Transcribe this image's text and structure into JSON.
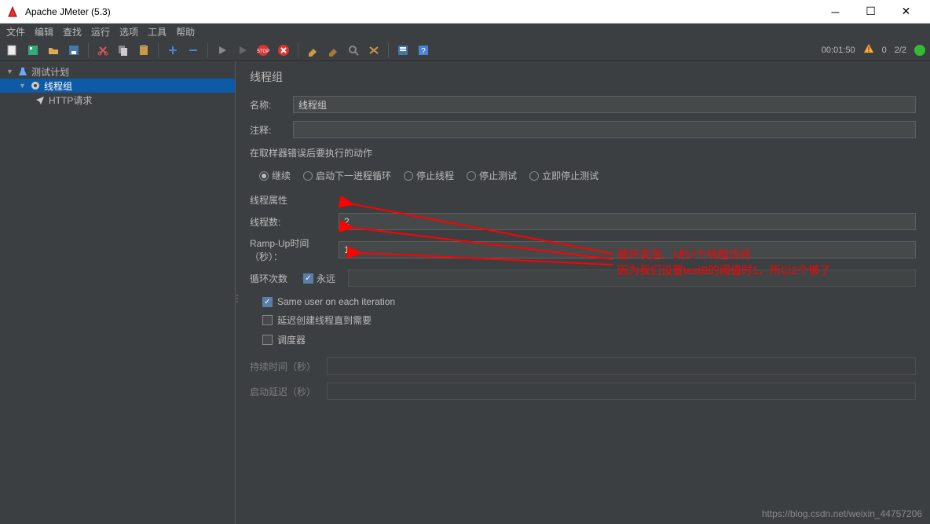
{
  "window": {
    "title": "Apache JMeter (5.3)"
  },
  "menu": [
    "文件",
    "编辑",
    "查找",
    "运行",
    "选项",
    "工具",
    "帮助"
  ],
  "status": {
    "time": "00:01:50",
    "warn": "0",
    "count": "2/2"
  },
  "tree": {
    "root": "测试计划",
    "child1": "线程组",
    "child2": "HTTP请求"
  },
  "panel": {
    "title": "线程组",
    "name_label": "名称:",
    "name_value": "线程组",
    "comment_label": "注释:",
    "error_section": "在取样器错误后要执行的动作",
    "radios": {
      "continue": "继续",
      "start_next": "启动下一进程循环",
      "stop_thread": "停止线程",
      "stop_test": "停止测试",
      "stop_now": "立即停止测试"
    },
    "thread_props": "线程属性",
    "threads_label": "线程数:",
    "threads_value": "2",
    "rampup_label": "Ramp-Up时间（秒）：",
    "rampup_value": "1",
    "loop_label": "循环次数",
    "loop_forever": "永远",
    "same_user": "Same user on each iteration",
    "delay_create": "延迟创建线程直到需要",
    "scheduler": "调度器",
    "duration_label": "持续时间（秒）",
    "startup_label": "启动延迟（秒）"
  },
  "annotation": {
    "line1": "循环发送，1秒2个线程访问",
    "line2": "因为我们设置testB的阈值时1，所以2个够了"
  },
  "watermark": "https://blog.csdn.net/weixin_44757206"
}
